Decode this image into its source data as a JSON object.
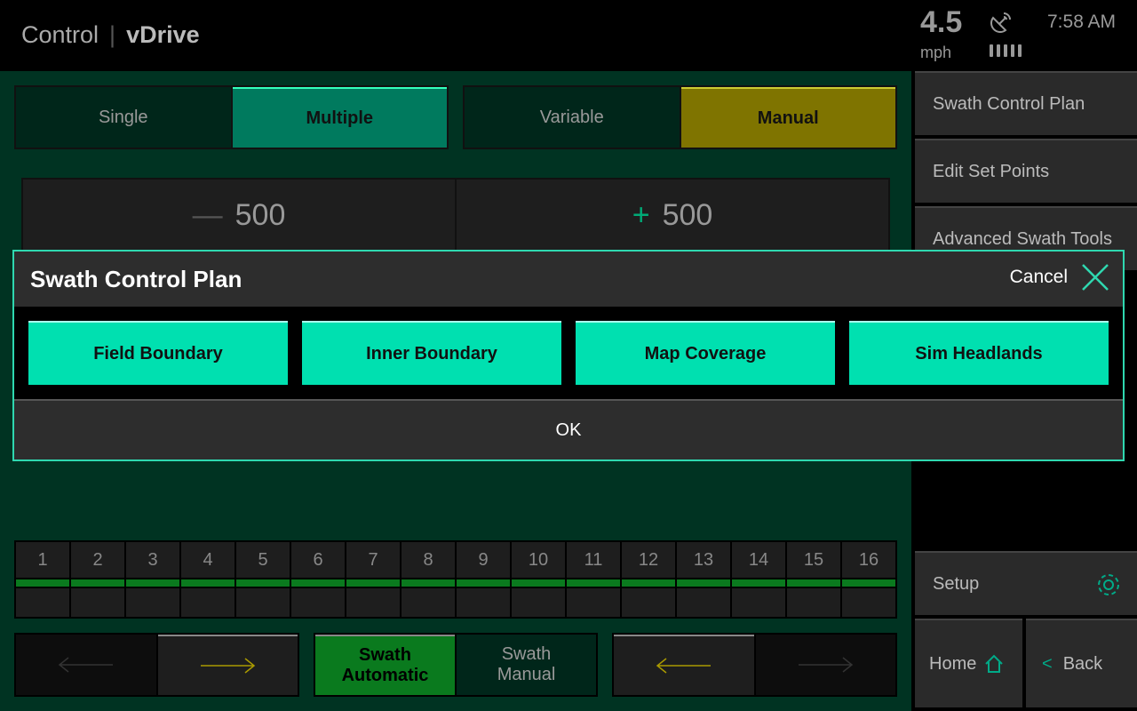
{
  "header": {
    "app": "Control",
    "page": "vDrive",
    "speed": "4.5",
    "speed_unit": "mph",
    "time": "7:58 AM",
    "icons": [
      "satellite-icon",
      "signal-bars-icon"
    ]
  },
  "mode_tabs": [
    {
      "label": "Single",
      "active": false
    },
    {
      "label": "Multiple",
      "active": true
    }
  ],
  "rate_tabs": [
    {
      "label": "Variable",
      "active": false
    },
    {
      "label": "Manual",
      "active": true
    }
  ],
  "rate": {
    "decrease_symbol": "—",
    "decrease_value": "500",
    "increase_symbol": "+",
    "increase_value": "500"
  },
  "sidebar": {
    "items": [
      "Swath Control Plan",
      "Edit Set Points",
      "Advanced Swath Tools"
    ],
    "setup": "Setup",
    "home": "Home",
    "back": "Back"
  },
  "dialog": {
    "title": "Swath Control Plan",
    "cancel": "Cancel",
    "options": [
      "Field Boundary",
      "Inner Boundary",
      "Map Coverage",
      "Sim Headlands"
    ],
    "ok": "OK"
  },
  "sections": [
    "1",
    "2",
    "3",
    "4",
    "5",
    "6",
    "7",
    "8",
    "9",
    "10",
    "11",
    "12",
    "13",
    "14",
    "15",
    "16"
  ],
  "swath": {
    "auto_line1": "Swath",
    "auto_line2": "Automatic",
    "manual_line1": "Swath",
    "manual_line2": "Manual"
  },
  "colors": {
    "accent": "#00e0b0",
    "active_green": "#0a7a1e",
    "manual_yellow": "#7f7400",
    "background": "#003322"
  }
}
